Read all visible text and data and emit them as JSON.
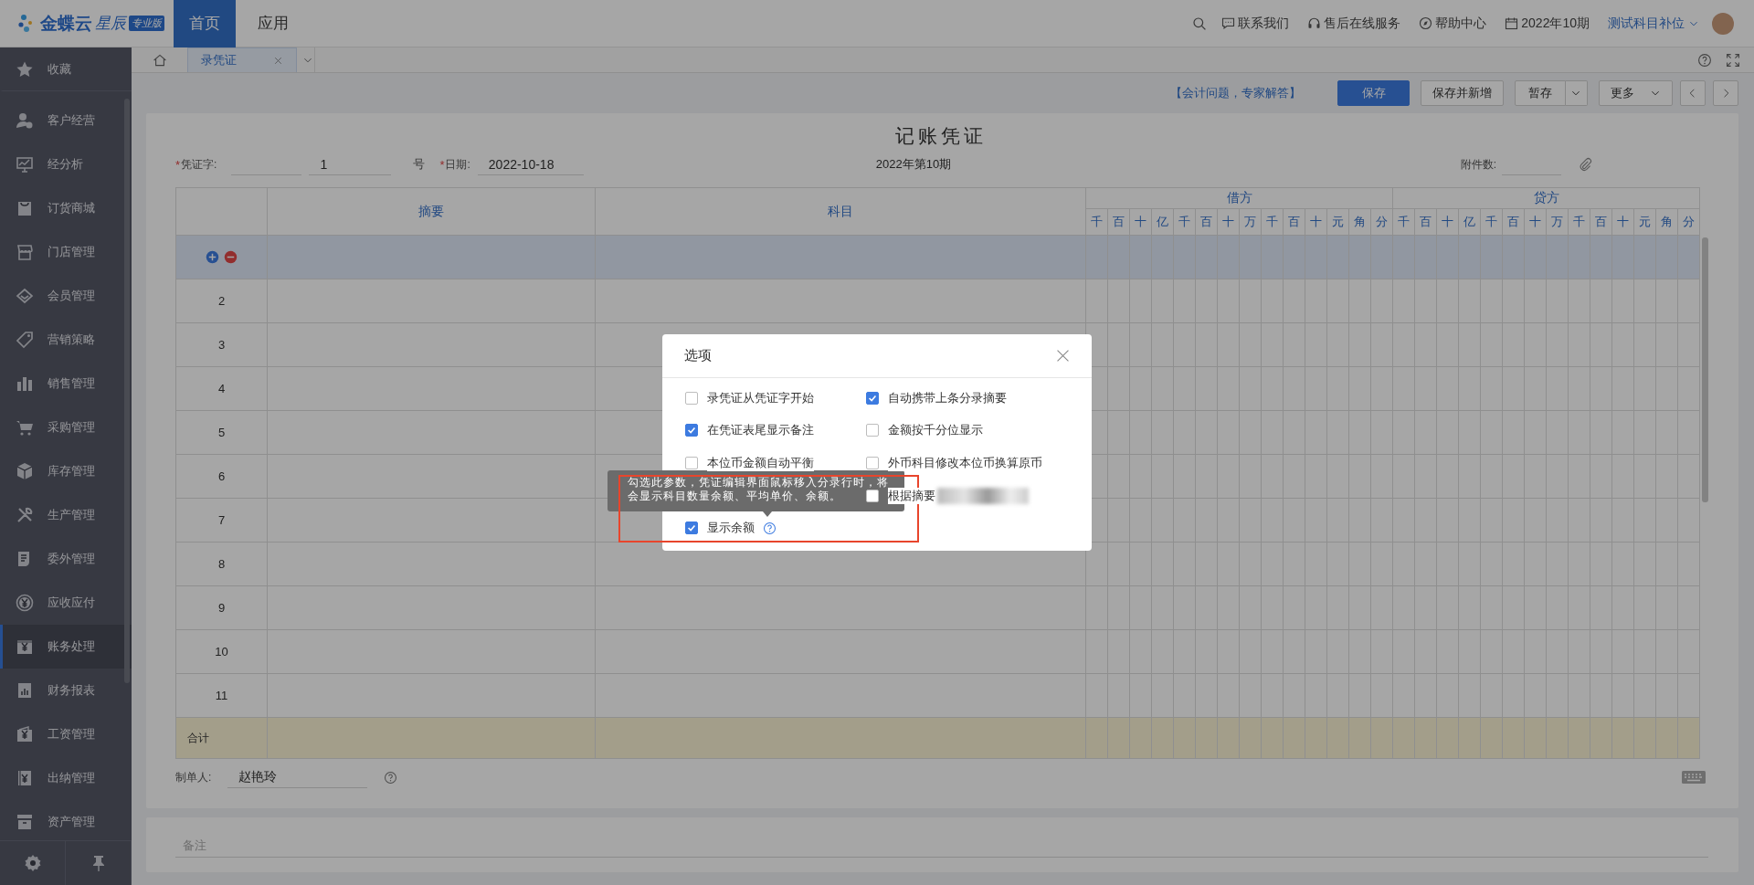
{
  "top_bar": {
    "logo": "金蝶云",
    "logo_sub": "星辰",
    "edition": "专业版",
    "nav": [
      {
        "label": "首页",
        "selected": true
      },
      {
        "label": "应用",
        "selected": false
      }
    ],
    "links": [
      "联系我们",
      "售后在线服务",
      "帮助中心"
    ],
    "period": "2022年10期",
    "account": "测试科目补位"
  },
  "sidebar": {
    "favorites": "收藏",
    "items": [
      {
        "label": "客户经营",
        "selected": false
      },
      {
        "label": "经分析",
        "selected": false
      },
      {
        "label": "订货商城",
        "selected": false
      },
      {
        "label": "门店管理",
        "selected": false
      },
      {
        "label": "会员管理",
        "selected": false
      },
      {
        "label": "营销策略",
        "selected": false
      },
      {
        "label": "销售管理",
        "selected": false
      },
      {
        "label": "采购管理",
        "selected": false
      },
      {
        "label": "库存管理",
        "selected": false
      },
      {
        "label": "生产管理",
        "selected": false
      },
      {
        "label": "委外管理",
        "selected": false
      },
      {
        "label": "应收应付",
        "selected": false
      },
      {
        "label": "账务处理",
        "selected": true
      },
      {
        "label": "财务报表",
        "selected": false
      },
      {
        "label": "工资管理",
        "selected": false
      },
      {
        "label": "出纳管理",
        "selected": false
      },
      {
        "label": "资产管理",
        "selected": false
      }
    ]
  },
  "tabs": [
    {
      "label": "录凭证",
      "selected": true
    }
  ],
  "toolbar": {
    "link": "【会计问题，专家解答】",
    "buttons": [
      {
        "label": "保存",
        "kind": "primary"
      },
      {
        "label": "保存并新增",
        "kind": "plain"
      },
      {
        "label": "暂存",
        "kind": "split"
      },
      {
        "label": "更多",
        "kind": "dropdown"
      }
    ]
  },
  "voucher": {
    "title": "记账凭证",
    "required_marks": [
      "*",
      "*"
    ],
    "word_label": "凭证字:",
    "number": "1",
    "number_suffix": "号",
    "date_label": "日期:",
    "date": "2022-10-18",
    "period": "2022年第10期",
    "attachments_label": "附件数:",
    "columns": {
      "summary": "摘要",
      "account": "科目",
      "debit": "借方",
      "credit": "贷方"
    },
    "debit_digits": [
      "千",
      "百",
      "十",
      "亿",
      "千",
      "百",
      "十",
      "万",
      "千",
      "百",
      "十",
      "元",
      "角",
      "分"
    ],
    "credit_digits": [
      "千",
      "百",
      "十",
      "亿",
      "千",
      "百",
      "十",
      "万",
      "千",
      "百",
      "十",
      "元",
      "角",
      "分"
    ],
    "rows": [
      {
        "selected": true
      },
      {
        "number": "2",
        "selected": false
      },
      {
        "number": "3",
        "selected": false
      },
      {
        "number": "4",
        "selected": false
      },
      {
        "number": "5",
        "selected": false
      },
      {
        "number": "6",
        "selected": false
      },
      {
        "number": "7",
        "selected": false
      },
      {
        "number": "8",
        "selected": false
      },
      {
        "number": "9",
        "selected": false
      },
      {
        "number": "10",
        "selected": false
      },
      {
        "number": "11",
        "selected": false
      }
    ],
    "total_label": "合计",
    "maker_label": "制单人:",
    "maker": "赵艳玲",
    "remark_placeholder": "备注"
  },
  "dialog": {
    "title": "选项",
    "rows": [
      {
        "left": {
          "label": "录凭证从凭证字开始",
          "checked": false
        },
        "right": {
          "label": "自动携带上条分录摘要",
          "checked": true
        }
      },
      {
        "left": {
          "label": "在凭证表尾显示备注",
          "checked": true
        },
        "right": {
          "label": "金额按千分位显示",
          "checked": false
        }
      },
      {
        "left": {
          "label": "本位币金额自动平衡",
          "checked": false
        },
        "right": {
          "label": "外币科目修改本位币换算原币",
          "checked": false
        }
      },
      {
        "right": {
          "label": "根据摘要",
          "checked": false,
          "redacted": true
        }
      },
      {
        "left": {
          "label": "显示余额",
          "checked": true,
          "help": true
        }
      }
    ],
    "tooltip": "勾选此参数，凭证编辑界面鼠标移入分录行时，将会显示科目数量余额、平均单价、余额。"
  }
}
